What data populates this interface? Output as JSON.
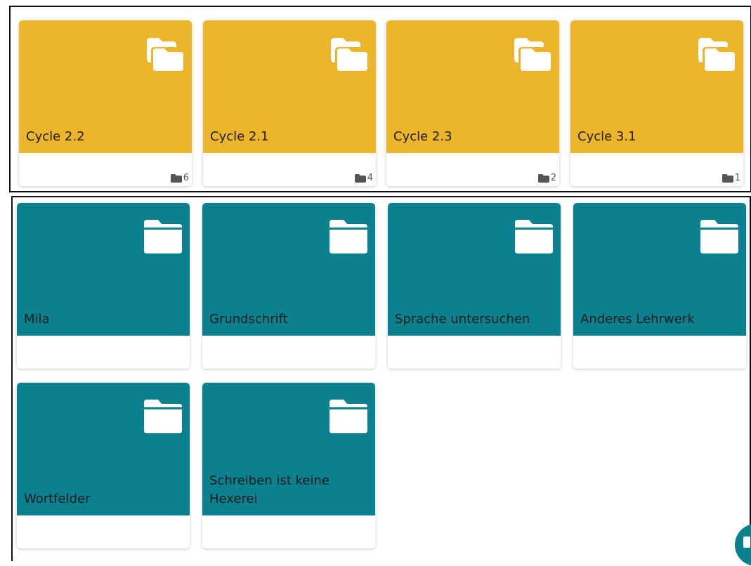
{
  "collections": [
    {
      "title": "Cycle 2.2",
      "count": "6"
    },
    {
      "title": "Cycle 2.1",
      "count": "4"
    },
    {
      "title": "Cycle 2.3",
      "count": "2"
    },
    {
      "title": "Cycle 3.1",
      "count": "1"
    }
  ],
  "folders": [
    {
      "title": "Mila"
    },
    {
      "title": "Grundschrift"
    },
    {
      "title": "Sprache untersuchen"
    },
    {
      "title": "Anderes Lehrwerk"
    },
    {
      "title": "Wortfelder"
    },
    {
      "title": "Schreiben ist keine Hexerei"
    }
  ],
  "icons": {
    "collection_icon": "folders-icon",
    "folder_icon": "folder-icon",
    "count_icon": "folder-count-icon"
  },
  "colors": {
    "collection_tile": "#ecb52a",
    "folder_tile": "#0b8190"
  }
}
